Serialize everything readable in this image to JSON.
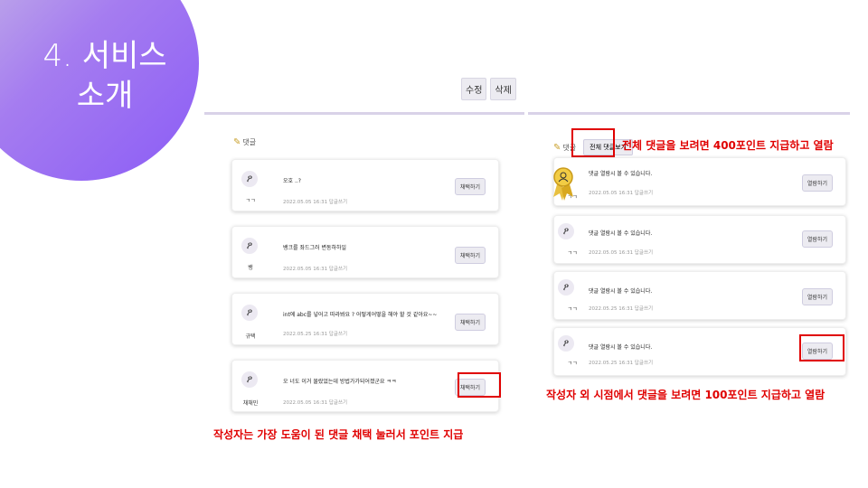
{
  "slide": {
    "title_line1": "4. 서비스",
    "title_line2": "소개"
  },
  "top_buttons": {
    "edit": "수정",
    "delete": "삭제"
  },
  "left_panel": {
    "section_label": "댓글",
    "comments": [
      {
        "author": "ㄱㄱ",
        "text": "오호 ..?",
        "meta": "2022.05.05 16:31   답글쓰기",
        "button": "채택하기"
      },
      {
        "author": "뱅",
        "text": "뱅크를 좌드그러 변동하하일",
        "meta": "2022.05.05 16:31   답글쓰기",
        "button": "채택하기"
      },
      {
        "author": "규택",
        "text": "int에 abc를 넣어고 따라봐요 ? 어떻게어떻을 해야 할 것 같아요~~",
        "meta": "2022.05.25 16:31   답글쓰기",
        "button": "채택하기"
      },
      {
        "author": "채채민",
        "text": "오 너도 이거 물랐었는데 방법가가되어졌군요 ㅋㅋ",
        "meta": "2022.05.05 16:31   답글쓰기",
        "button": "채택하기"
      }
    ],
    "annotation": "작성자는 가장 도움이 된 댓글 채택 눌러서 포인트 지급"
  },
  "right_panel": {
    "section_label": "댓글",
    "view_all_button": "전체 댓글보기",
    "view_all_annotation": "전체 댓글을 보려면 400포인트 지급하고 열람",
    "comments": [
      {
        "author": "ㄱㄱ",
        "text": "댓글 열람시 볼 수 있습니다.",
        "meta": "2022.05.05 16:31   답글쓰기",
        "button": "열람하기"
      },
      {
        "author": "ㄱㄱ",
        "text": "댓글 열람시 볼 수 있습니다.",
        "meta": "2022.05.05 16:31   답글쓰기",
        "button": "열람하기"
      },
      {
        "author": "ㄱㄱ",
        "text": "댓글 열람시 볼 수 있습니다.",
        "meta": "2022.05.25 16:31   답글쓰기",
        "button": "열람하기"
      },
      {
        "author": "ㄱㄱ",
        "text": "댓글 열람시 볼 수 있습니다.",
        "meta": "2022.05.25 16:31   답글쓰기",
        "button": "열람하기"
      }
    ],
    "annotation": "작성자 외 시점에서 댓글을 보려면 100포인트 지급하고 열람"
  },
  "colors": {
    "accent": "#8b5cf6",
    "annotation_red": "#e00000"
  },
  "icons": {
    "avatar": "user-icon",
    "pencil": "pencil-icon",
    "medal": "medal-icon"
  }
}
